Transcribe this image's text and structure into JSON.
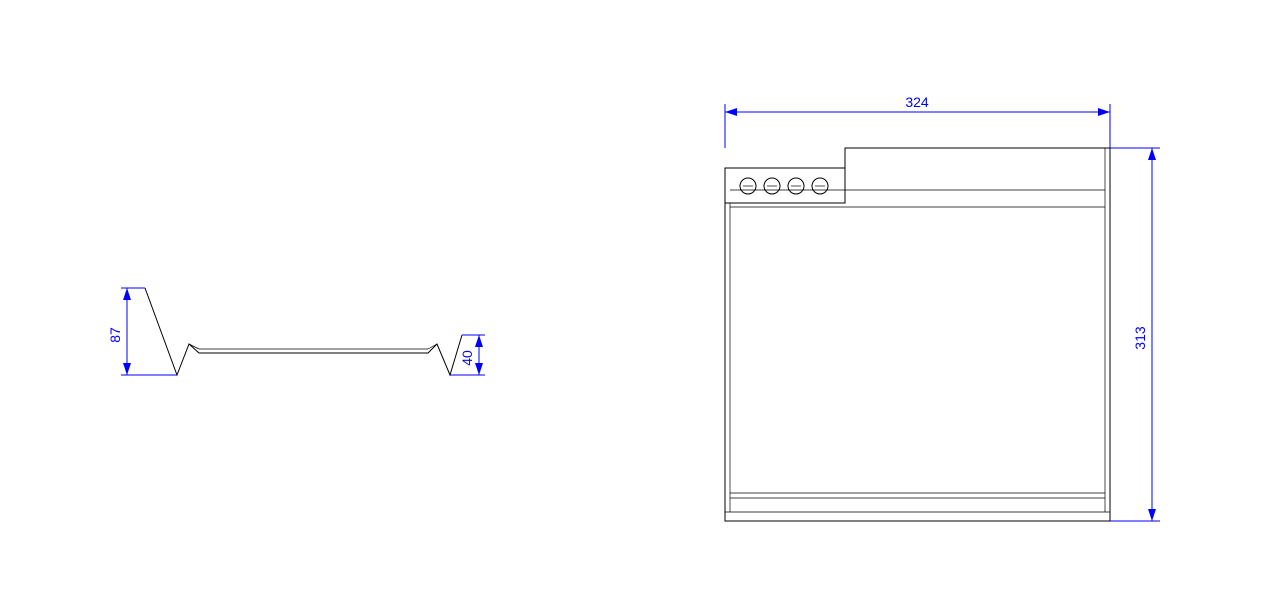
{
  "drawing": {
    "left_view": {
      "dimensions": {
        "height_87": 87,
        "height_40": 40
      }
    },
    "right_view": {
      "dimensions": {
        "width_324": 324,
        "height_313": 313
      }
    }
  }
}
